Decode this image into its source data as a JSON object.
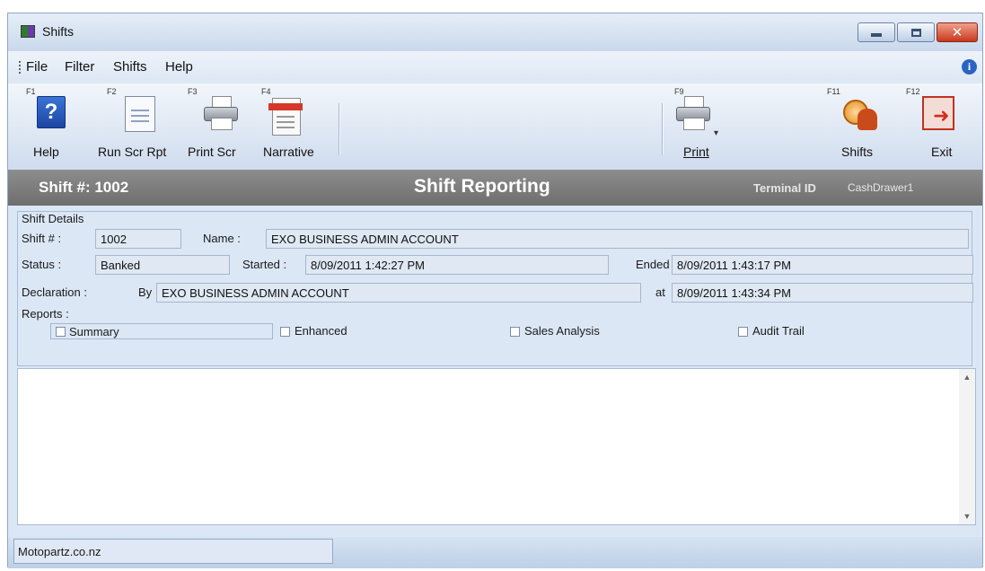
{
  "window": {
    "title": "Shifts"
  },
  "menu": {
    "items": [
      "File",
      "Filter",
      "Shifts",
      "Help"
    ]
  },
  "toolbar": {
    "help": {
      "key": "F1",
      "label": "Help"
    },
    "run_scr_rpt": {
      "key": "F2",
      "label": "Run Scr Rpt"
    },
    "print_scr": {
      "key": "F3",
      "label": "Print Scr"
    },
    "narrative": {
      "key": "F4",
      "label": "Narrative"
    },
    "print": {
      "key": "F9",
      "label": "Print"
    },
    "shifts": {
      "key": "F11",
      "label": "Shifts"
    },
    "exit": {
      "key": "F12",
      "label": "Exit"
    }
  },
  "banner": {
    "shift_number": "Shift #: 1002",
    "title": "Shift Reporting",
    "terminal_label": "Terminal ID",
    "terminal_value": "CashDrawer1"
  },
  "details": {
    "group_label": "Shift Details",
    "shift_label": "Shift # :",
    "shift_value": "1002",
    "name_label": "Name :",
    "name_value": "EXO BUSINESS ADMIN ACCOUNT",
    "status_label": "Status :",
    "status_value": "Banked",
    "started_label": "Started :",
    "started_value": "8/09/2011 1:42:27 PM",
    "ended_label": "Ended",
    "ended_value": "8/09/2011 1:43:17 PM",
    "declaration_label": "Declaration :",
    "by_label": "By",
    "by_value": "EXO BUSINESS ADMIN ACCOUNT",
    "at_label": "at",
    "at_value": "8/09/2011 1:43:34 PM",
    "reports_label": "Reports :",
    "reports": {
      "summary": "Summary",
      "enhanced": "Enhanced",
      "sales_analysis": "Sales Analysis",
      "audit_trail": "Audit Trail"
    }
  },
  "status": {
    "text": "Motopartz.co.nz"
  }
}
